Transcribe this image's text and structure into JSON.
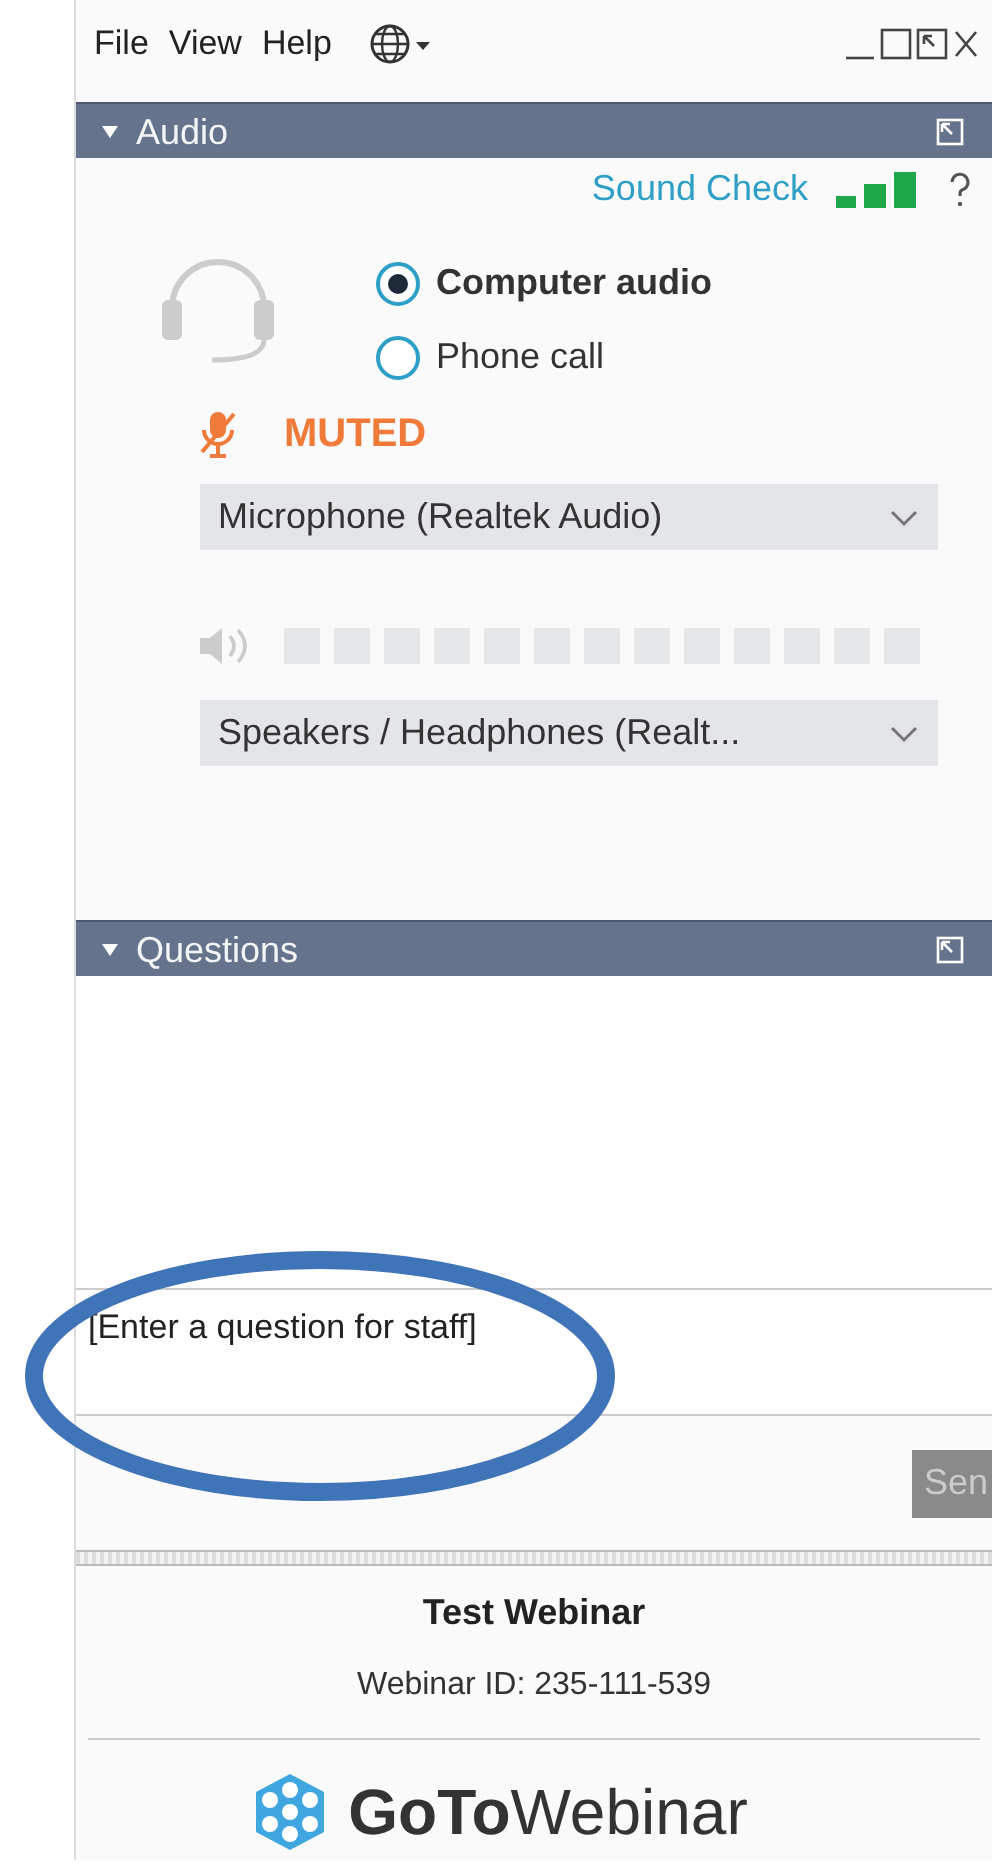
{
  "menu": [
    "File",
    "View",
    "Help"
  ],
  "audio": {
    "title": "Audio",
    "expanded": true,
    "sound_check": "Sound Check",
    "options": [
      {
        "label": "Computer audio",
        "selected": true
      },
      {
        "label": "Phone call",
        "selected": false
      }
    ],
    "microphone": {
      "muted": true,
      "status": "MUTED",
      "device": "Microphone (Realtek Audio)"
    },
    "speakers": {
      "level": 0,
      "device": "Speakers / Headphones (Realt..."
    }
  },
  "questions": {
    "title": "Questions",
    "expanded": true,
    "placeholder": "[Enter a question for staff]",
    "send": "Sen"
  },
  "webinar": {
    "title": "Test Webinar",
    "id": "Webinar ID: 235-111-539",
    "logo": "**GoTo**Webinar"
  }
}
